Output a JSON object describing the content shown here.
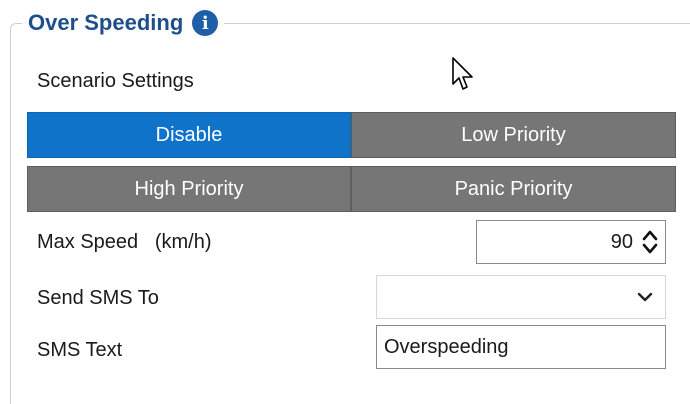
{
  "group": {
    "title": "Over Speeding",
    "info_icon": "info-icon"
  },
  "scenario": {
    "label": "Scenario Settings",
    "buttons": [
      {
        "label": "Disable",
        "selected": true
      },
      {
        "label": "Low Priority",
        "selected": false
      },
      {
        "label": "High Priority",
        "selected": false
      },
      {
        "label": "Panic Priority",
        "selected": false
      }
    ],
    "active_color": "#0f74c9",
    "inactive_color": "#767676"
  },
  "max_speed": {
    "label": "Max Speed   (km/h)",
    "value": "90"
  },
  "send_sms_to": {
    "label": "Send SMS To",
    "value": ""
  },
  "sms_text": {
    "label": "SMS Text",
    "value": "Overspeeding"
  }
}
